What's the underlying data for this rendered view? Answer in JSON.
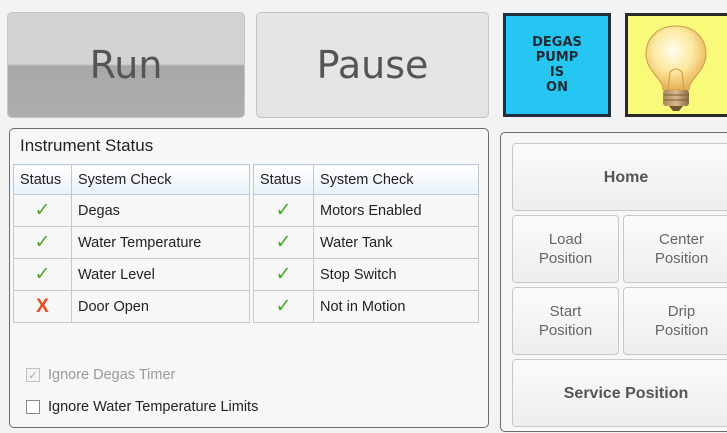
{
  "toolbar": {
    "run_label": "Run",
    "pause_label": "Pause",
    "degas_indicator": [
      "DEGAS",
      "PUMP",
      "IS",
      "ON"
    ],
    "degas_color": "#26c6f2",
    "bulb_color": "#fafa7a",
    "bulb_icon": "lightbulb-icon"
  },
  "instrument_status": {
    "title": "Instrument Status",
    "headers": {
      "status": "Status",
      "check": "System Check"
    },
    "left": [
      {
        "ok": true,
        "label": "Degas"
      },
      {
        "ok": true,
        "label": "Water Temperature"
      },
      {
        "ok": true,
        "label": "Water Level"
      },
      {
        "ok": false,
        "label": "Door Open"
      }
    ],
    "right": [
      {
        "ok": true,
        "label": "Motors Enabled"
      },
      {
        "ok": true,
        "label": "Water Tank"
      },
      {
        "ok": true,
        "label": "Stop Switch"
      },
      {
        "ok": true,
        "label": "Not in Motion"
      }
    ],
    "ok_glyph": "✓",
    "bad_glyph": "X",
    "ok_color": "#4ca52c",
    "bad_color": "#e24b1e",
    "options": [
      {
        "label": "Ignore Degas Timer",
        "checked": true,
        "enabled": false
      },
      {
        "label": "Ignore Water Temperature Limits",
        "checked": false,
        "enabled": true
      }
    ]
  },
  "positions": {
    "home": "Home",
    "load": [
      "Load",
      "Position"
    ],
    "center": [
      "Center",
      "Position"
    ],
    "start": [
      "Start",
      "Position"
    ],
    "drip": [
      "Drip",
      "Position"
    ],
    "service": "Service Position"
  }
}
